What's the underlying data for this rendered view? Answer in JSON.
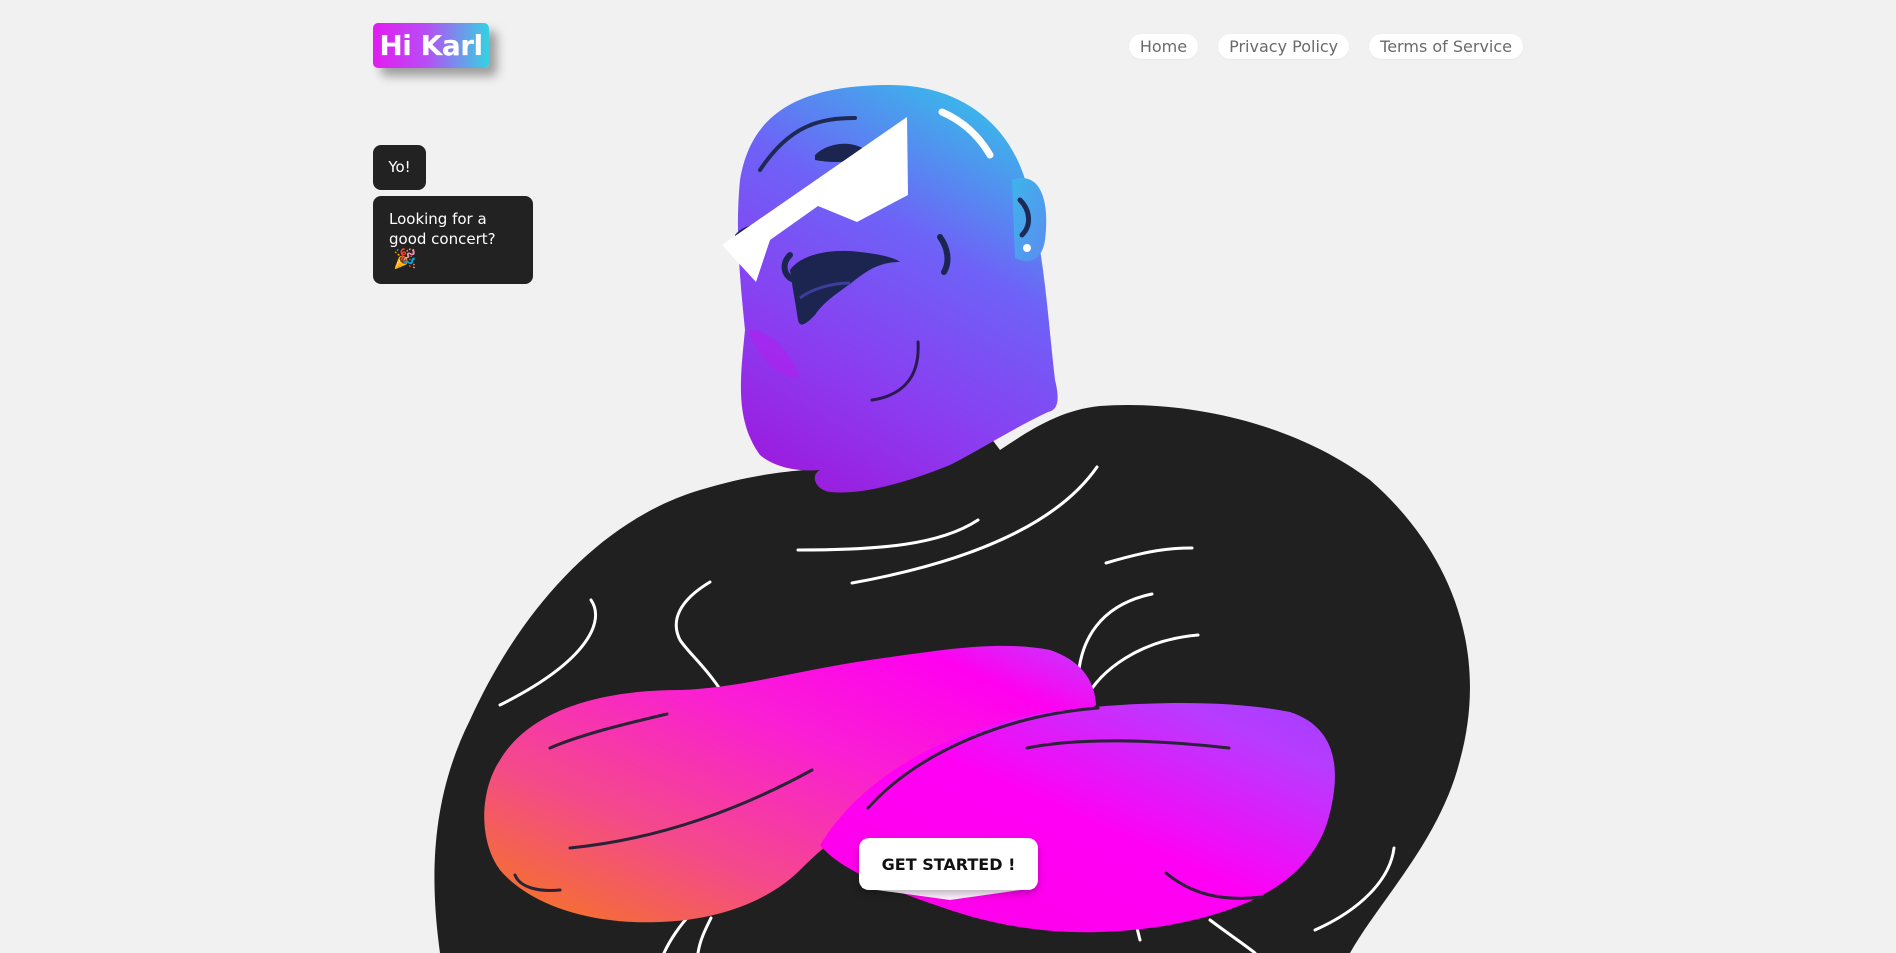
{
  "header": {
    "logo_text": "Hi Karl",
    "nav": [
      {
        "label": "Home"
      },
      {
        "label": "Privacy Policy"
      },
      {
        "label": "Terms of Service"
      }
    ]
  },
  "chat": {
    "message_1": "Yo!",
    "message_2": "Looking for a good concert?",
    "message_2_emoji": "🎉"
  },
  "cta": {
    "label": "GET STARTED !"
  },
  "illustration": {
    "subject": "bald man with sunglasses and crossed arms",
    "colors": {
      "head_top": "#38b7e8",
      "head_mid": "#7b5cf5",
      "head_bottom": "#a11de8",
      "shirt": "#222222",
      "arm_orange": "#f48a12",
      "arm_pink": "#ff1fd2",
      "arm_purple": "#a63cff",
      "glasses": "#ffffff",
      "background": "#f1f1f1"
    }
  }
}
